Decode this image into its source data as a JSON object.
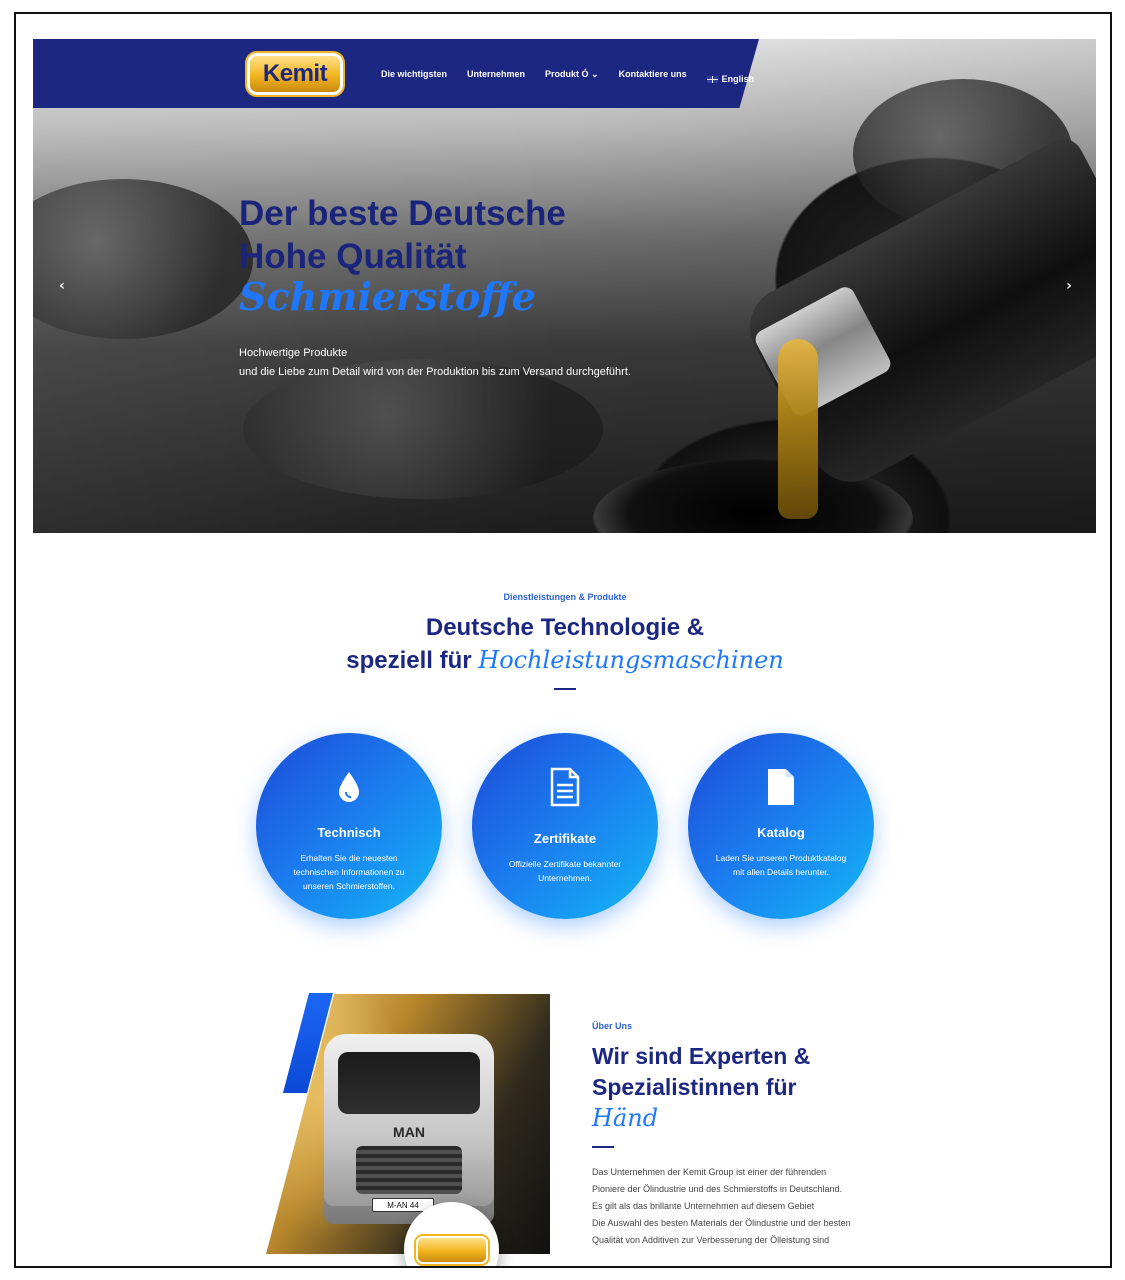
{
  "brand": {
    "logo_text": "Kemit"
  },
  "nav": {
    "items": [
      {
        "label": "Die wichtigsten"
      },
      {
        "label": "Unternehmen"
      },
      {
        "label": "Produkt Ó ⌄"
      },
      {
        "label": "Kontaktiere uns"
      },
      {
        "label": "English"
      }
    ]
  },
  "hero": {
    "line1": "Der beste Deutsche",
    "line2": "Hohe Qualität",
    "script": "Schmierstoffe",
    "sub1": "Hochwertige Produkte",
    "sub2": "und die Liebe zum Detail wird von der Produktion bis zum Versand durchgeführt.",
    "prev": "‹",
    "next": "›"
  },
  "services": {
    "kicker": "Dienstleistungen & Produkte",
    "title_line1": "Deutsche Technologie &",
    "title_line2_plain": "speziell für ",
    "title_line2_script": "Hochleistungsmaschinen",
    "items": [
      {
        "icon": "droplet-icon",
        "title": "Technisch",
        "text": "Erhalten Sie die neuesten technischen Informationen zu unseren Schmierstoffen."
      },
      {
        "icon": "document-icon",
        "title": "Zertifikate",
        "text": "Offizielle Zertifikate bekannter Unternehmen."
      },
      {
        "icon": "file-icon",
        "title": "Katalog",
        "text": "Laden Sie unseren Produktkatalog mit allen Details herunter."
      }
    ]
  },
  "about": {
    "kicker": "Über Uns",
    "title": "Wir sind Experten & Spezialistinnen für",
    "script": "Händ",
    "truck_badge": "MAN",
    "truck_plate": "M-AN 44",
    "paragraph_lines": [
      "Das Unternehmen der Kemit Group ist einer der führenden",
      "Pioniere der Ölindustrie und des Schmierstoffs in Deutschland.",
      "Es gilt als das brillante Unternehmen auf diesem Gebiet",
      "Die Auswahl des besten Materials der Ölindustrie und der besten",
      "Qualität von Additiven zur Verbesserung der Ölleistung sind"
    ]
  },
  "colors": {
    "navy": "#1c2781",
    "accent_blue": "#1e78ff",
    "gold": "#f2b51f"
  }
}
